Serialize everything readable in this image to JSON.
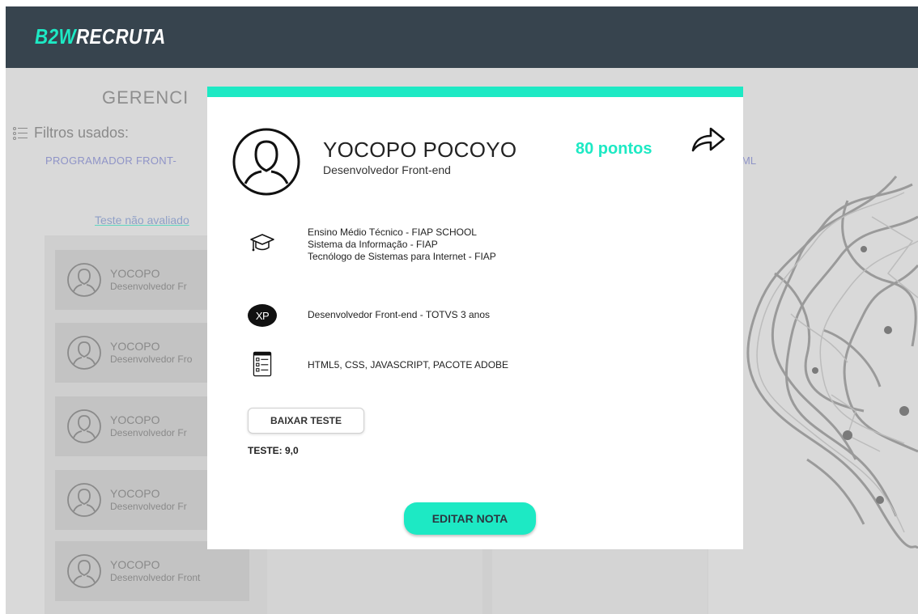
{
  "header": {
    "brand_part1": "B2W",
    "brand_part2": "RECRUTA"
  },
  "background": {
    "page_title": "GERENCI",
    "filters_label": "Filtros usados:",
    "filter_chip_left": "PROGRAMADOR FRONT-",
    "filter_chip_right": "ML",
    "tab_link": "Teste não avaliado",
    "cards": [
      {
        "name": "YOCOPO",
        "role": "Desenvolvedor Fr"
      },
      {
        "name": "YOCOPO",
        "role": "Desenvolvedor Fro"
      },
      {
        "name": "YOCOPO",
        "role": "Desenvolvedor Fr"
      },
      {
        "name": "YOCOPO",
        "role": "Desenvolvedor Fr"
      },
      {
        "name": "YOCOPO",
        "role": "Desenvolvedor Front"
      }
    ]
  },
  "modal": {
    "candidate_name": "YOCOPO POCOYO",
    "candidate_role": "Desenvolvedor Front-end",
    "points": "80 pontos",
    "education": [
      "Ensino Médio Técnico - FIAP SCHOOL",
      "Sistema da Informação - FIAP",
      "Tecnólogo de Sistemas para Internet - FIAP"
    ],
    "xp_badge": "XP",
    "experience": "Desenvolvedor Front-end - TOTVS 3 anos",
    "skills": "HTML5, CSS, JAVASCRIPT, PACOTE ADOBE",
    "download_button": "BAIXAR TESTE",
    "test_score": "TESTE: 9,0",
    "edit_button": "EDITAR NOTA"
  },
  "colors": {
    "accent": "#1de9c4",
    "header_bg": "#37444e",
    "overlay": "#d9d9d9"
  }
}
